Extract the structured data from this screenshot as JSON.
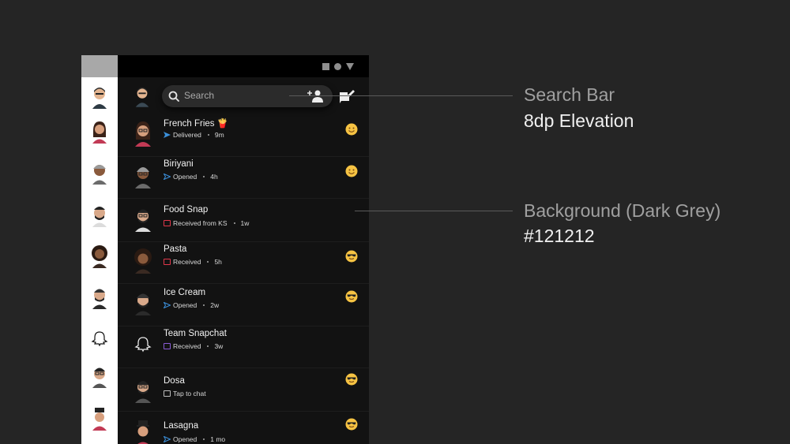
{
  "search": {
    "placeholder": "Search"
  },
  "chats": [
    {
      "name": "French Fries 🍟",
      "status": "Delivered",
      "time": "9m",
      "status_icon": "delivered-arrow-icon",
      "status_color": "#3b8fd9",
      "emoji": "smiling-face-icon"
    },
    {
      "name": "Biriyani",
      "status": "Opened",
      "time": "4h",
      "status_icon": "opened-arrow-icon",
      "status_color": "#3b8fd9",
      "emoji": "smiling-face-icon"
    },
    {
      "name": "Food Snap",
      "status": "Received from KS",
      "time": "1w",
      "status_icon": "received-snap-icon",
      "status_color": "#e0374a",
      "emoji": ""
    },
    {
      "name": "Pasta",
      "status": "Received",
      "time": "5h",
      "status_icon": "received-snap-icon",
      "status_color": "#e0374a",
      "emoji": "sunglasses-face-icon"
    },
    {
      "name": "Ice Cream",
      "status": "Opened",
      "time": "2w",
      "status_icon": "opened-arrow-icon",
      "status_color": "#3b8fd9",
      "emoji": "sunglasses-face-icon"
    },
    {
      "name": "Team Snapchat",
      "status": "Received",
      "time": "3w",
      "status_icon": "received-chat-icon",
      "status_color": "#8a5cd6",
      "emoji": ""
    },
    {
      "name": "Dosa",
      "status": "Tap to chat",
      "time": "",
      "status_icon": "tap-to-chat-icon",
      "status_color": "#bdbdbd",
      "emoji": "sunglasses-face-icon"
    },
    {
      "name": "Lasagna",
      "status": "Opened",
      "time": "1 mo",
      "status_icon": "opened-arrow-icon",
      "status_color": "#3b8fd9",
      "emoji": "sunglasses-face-icon"
    }
  ],
  "annotations": {
    "search_title": "Search Bar",
    "search_value": "8dp Elevation",
    "background_title": "Background (Dark Grey)",
    "background_value": "#121212"
  },
  "colors": {
    "background": "#121212",
    "canvas": "#252525",
    "search_bar": "#2b2b2b",
    "emoji_yellow": "#f6c343"
  }
}
